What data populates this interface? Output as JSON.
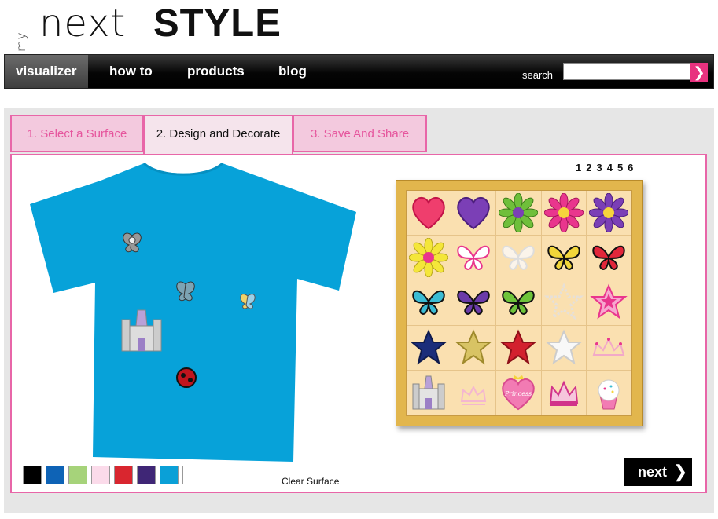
{
  "brand": {
    "my": "my",
    "next": "next",
    "style": "STYLE"
  },
  "nav": {
    "items": [
      "visualizer",
      "how to",
      "products",
      "blog"
    ],
    "search_label": "search",
    "search_value": ""
  },
  "tabs": [
    "1. Select a Surface",
    "2. Design and Decorate",
    "3. Save And Share"
  ],
  "pages": [
    "1",
    "2",
    "3",
    "4",
    "5",
    "6"
  ],
  "colors": {
    "accent": "#e866a8",
    "shirt": "#07a2d9",
    "swatches": [
      "#000000",
      "#0e63b6",
      "#a6d37a",
      "#fbdbea",
      "#d9262f",
      "#3f2676",
      "#0aa0d7",
      "#ffffff"
    ]
  },
  "stickers": [
    "heart-red-icon",
    "heart-purple-icon",
    "flower-green-icon",
    "flower-pink-icon",
    "flower-purple-icon",
    "flower-yellow-icon",
    "butterfly-pink-outline-icon",
    "butterfly-white-icon",
    "butterfly-yellow-icon",
    "butterfly-red-icon",
    "butterfly-blue-icon",
    "butterfly-purple-icon",
    "butterfly-green-icon",
    "star-pearl-icon",
    "star-pink-icon",
    "star-navy-icon",
    "star-gold-icon",
    "star-red-icon",
    "star-white-icon",
    "tiara-pink-icon",
    "castle-icon",
    "crown-pink-icon",
    "heart-princess-icon",
    "crown-magenta-icon",
    "cupcake-icon"
  ],
  "princess_text": "Princess",
  "actions": {
    "clear": "Clear Surface",
    "next": "next"
  }
}
